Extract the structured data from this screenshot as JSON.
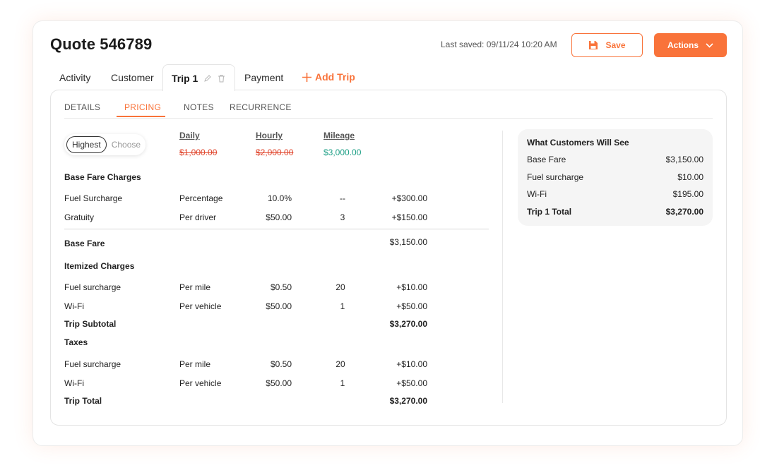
{
  "header": {
    "title": "Quote 546789",
    "last_saved": "Last saved: 09/11/24 10:20 AM",
    "save_label": "Save",
    "actions_label": "Actions"
  },
  "tabs": {
    "activity": "Activity",
    "customer": "Customer",
    "trip": "Trip 1",
    "payment": "Payment",
    "add_trip": "Add Trip"
  },
  "subtabs": [
    "DETAILS",
    "PRICING",
    "NOTES",
    "RECURRENCE"
  ],
  "rate_toggle": {
    "options": [
      "Highest",
      "Choose"
    ],
    "selected": "Highest"
  },
  "rates": {
    "daily": {
      "label": "Daily",
      "value": "$1,000.00"
    },
    "hourly": {
      "label": "Hourly",
      "value": "$2,000.00"
    },
    "mileage": {
      "label": "Mileage",
      "value": "$3,000.00"
    }
  },
  "sections": {
    "base_fare_charges": "Base Fare Charges",
    "base_fare": {
      "label": "Base Fare",
      "amount": "$3,150.00"
    },
    "itemized_charges": "Itemized Charges",
    "trip_subtotal": {
      "label": "Trip Subtotal",
      "amount": "$3,270.00"
    },
    "taxes": "Taxes",
    "trip_total": {
      "label": "Trip Total",
      "amount": "$3,270.00"
    }
  },
  "base_fare_rows": [
    {
      "name": "Fuel Surcharge",
      "type": "Percentage",
      "rate": "10.0%",
      "qty": "--",
      "amount": "+$300.00"
    },
    {
      "name": "Gratuity",
      "type": "Per driver",
      "rate": "$50.00",
      "qty": "3",
      "amount": "+$150.00"
    }
  ],
  "itemized_rows": [
    {
      "name": "Fuel surcharge",
      "type": "Per mile",
      "rate": "$0.50",
      "qty": "20",
      "amount": "+$10.00"
    },
    {
      "name": "Wi-Fi",
      "type": "Per vehicle",
      "rate": "$50.00",
      "qty": "1",
      "amount": "+$50.00"
    }
  ],
  "tax_rows": [
    {
      "name": "Fuel surcharge",
      "type": "Per mile",
      "rate": "$0.50",
      "qty": "20",
      "amount": "+$10.00"
    },
    {
      "name": "Wi-Fi",
      "type": "Per vehicle",
      "rate": "$50.00",
      "qty": "1",
      "amount": "+$50.00"
    }
  ],
  "summary": {
    "title": "What Customers Will See",
    "rows": [
      {
        "label": "Base Fare",
        "value": "$3,150.00"
      },
      {
        "label": "Fuel surcharge",
        "value": "$10.00"
      },
      {
        "label": "Wi-Fi",
        "value": "$195.00"
      }
    ],
    "total": {
      "label": "Trip 1 Total",
      "value": "$3,270.00"
    }
  },
  "colors": {
    "accent": "#f9733a",
    "strike": "#e0452c",
    "positive": "#1a9e84"
  }
}
